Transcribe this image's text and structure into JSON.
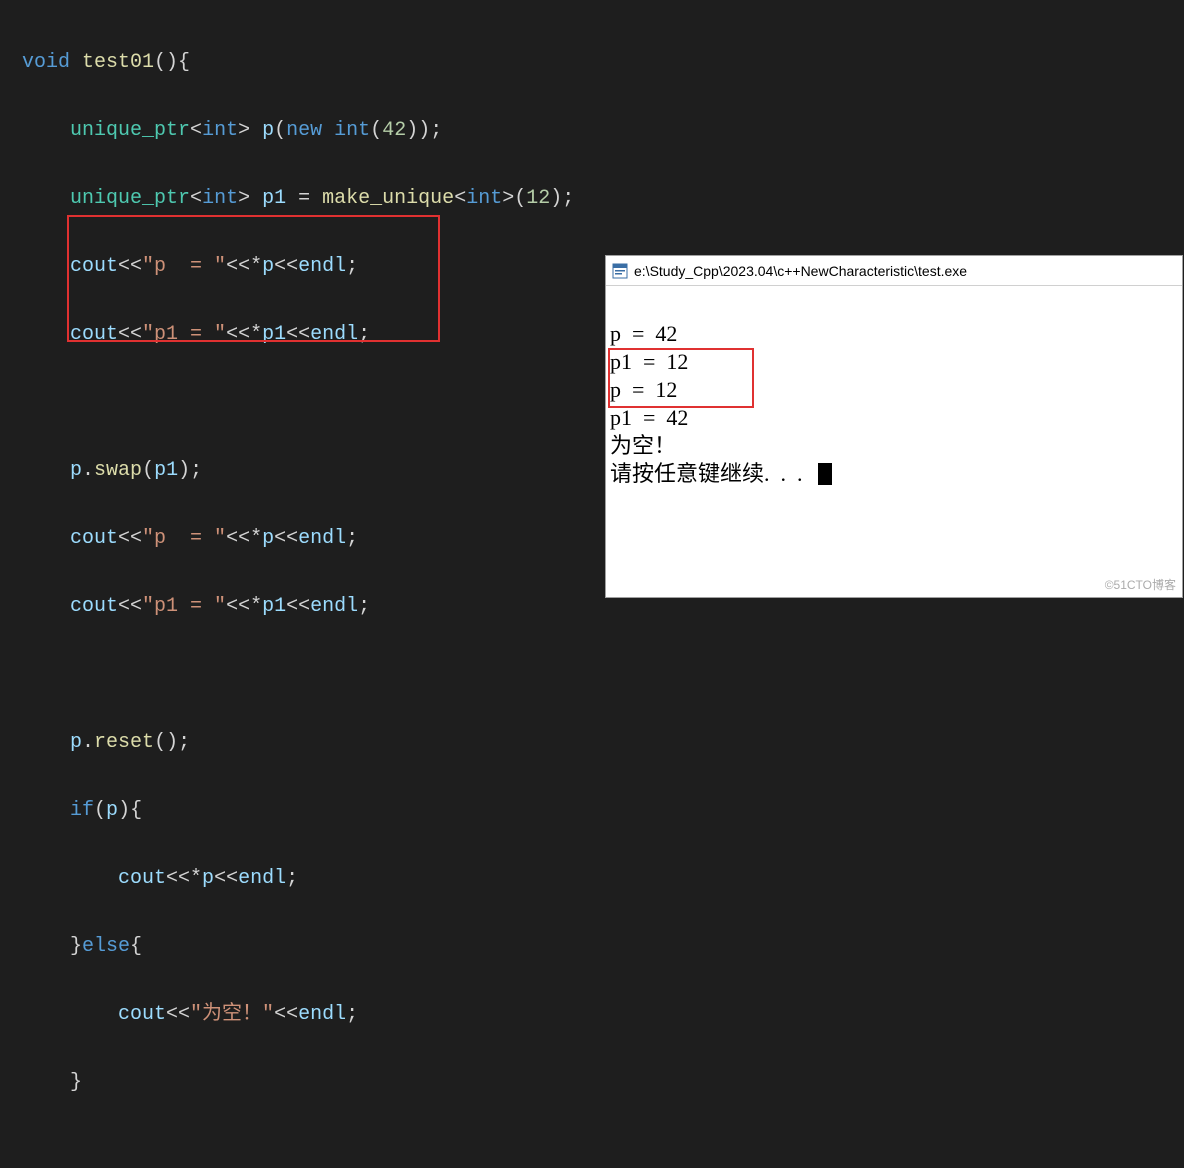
{
  "code": {
    "fn_decl": {
      "ret": "void",
      "name": "test01"
    },
    "line1": {
      "type": "unique_ptr",
      "tpl": "int",
      "var": "p",
      "kw": "new",
      "cast": "int",
      "num": "42"
    },
    "line2": {
      "type": "unique_ptr",
      "tpl": "int",
      "var": "p1",
      "eq": "=",
      "fn": "make_unique",
      "tpl2": "int",
      "num": "12"
    },
    "line3": {
      "cout": "cout",
      "str": "\"p  = \"",
      "deref": "*p",
      "endl": "endl"
    },
    "line4": {
      "cout": "cout",
      "str": "\"p1 = \"",
      "deref": "*p1",
      "endl": "endl"
    },
    "line5": {
      "obj": "p",
      "method": "swap",
      "arg": "p1"
    },
    "line6": {
      "cout": "cout",
      "str": "\"p  = \"",
      "deref": "*p",
      "endl": "endl"
    },
    "line7": {
      "cout": "cout",
      "str": "\"p1 = \"",
      "deref": "*p1",
      "endl": "endl"
    },
    "line8": {
      "obj": "p",
      "method": "reset"
    },
    "line9": {
      "kw": "if",
      "cond": "p"
    },
    "line10": {
      "cout": "cout",
      "deref": "*p",
      "endl": "endl"
    },
    "line11": {
      "kw": "else"
    },
    "line12": {
      "cout": "cout",
      "str": "\"为空！\"",
      "endl": "endl"
    }
  },
  "console": {
    "title": "e:\\Study_Cpp\\2023.04\\c++NewCharacteristic\\test.exe",
    "lines": {
      "l1": "p  =  42",
      "l2": "p1  =  12",
      "l3": "p  =  12",
      "l4": "p1  =  42",
      "l5": "为空！",
      "l6": "请按任意键继续.  .  .  "
    }
  },
  "watermark": "©51CTO博客"
}
